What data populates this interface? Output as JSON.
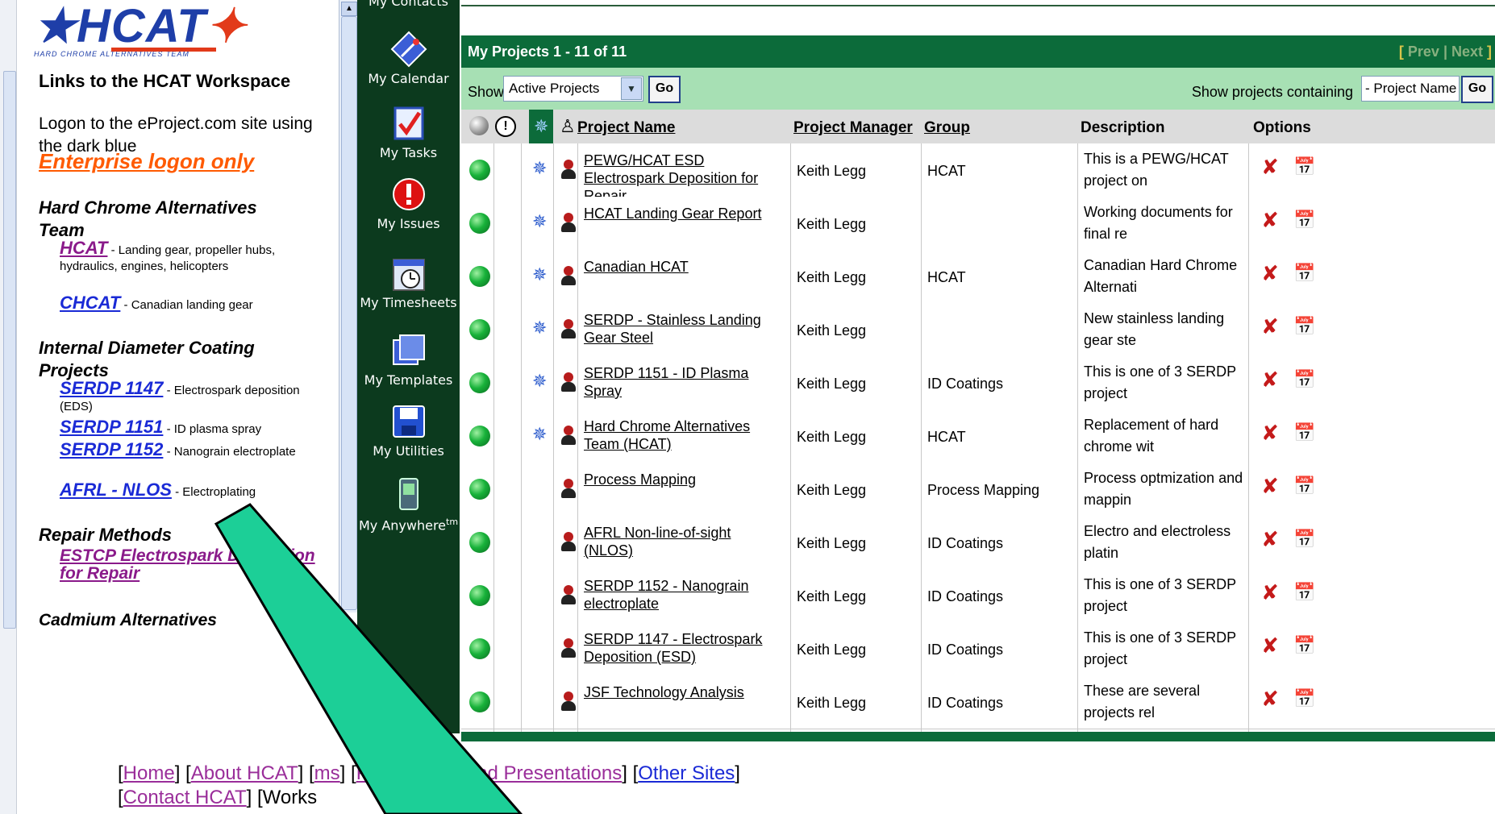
{
  "left": {
    "workspace_heading": "Links to the HCAT Workspace",
    "logon_text": "Logon to the eProject.com site using the dark blue",
    "enterprise_link": "Enterprise logon only",
    "logo_text": "HCAT",
    "logo_tagline": "HARD CHROME ALTERNATIVES TEAM",
    "sections": [
      {
        "title": "Hard Chrome Alternatives Team"
      },
      {
        "title": "Internal Diameter Coating Projects"
      },
      {
        "title": "Repair Methods"
      },
      {
        "title": "Cadmium Alternatives"
      }
    ],
    "links": [
      {
        "label": "HCAT",
        "desc": " - Landing gear, propeller hubs, hydraulics, engines, helicopters"
      },
      {
        "label": "CHCAT",
        "desc": " - Canadian landing gear"
      },
      {
        "label": "SERDP 1147",
        "desc": " - Electrospark deposition (EDS)"
      },
      {
        "label": "SERDP 1151",
        "desc": " - ID plasma spray"
      },
      {
        "label": "SERDP 1152",
        "desc": " - Nanograin electroplate"
      },
      {
        "label": "AFRL - NLOS",
        "desc": " - Electroplating"
      },
      {
        "label": "ESTCP Electrospark Deposition for Repair",
        "desc": ""
      }
    ]
  },
  "nav": {
    "items": [
      {
        "label": "My Contacts",
        "icon": "contacts-icon"
      },
      {
        "label": "My Calendar",
        "icon": "calendar-icon"
      },
      {
        "label": "My Tasks",
        "icon": "tasks-icon"
      },
      {
        "label": "My Issues",
        "icon": "issues-icon"
      },
      {
        "label": "My Timesheets",
        "icon": "timesheets-icon"
      },
      {
        "label": "My Templates",
        "icon": "templates-icon"
      },
      {
        "label": "My Utilities",
        "icon": "utilities-icon"
      },
      {
        "label": "My Anywhere",
        "icon": "anywhere-icon",
        "sup": "tm"
      }
    ]
  },
  "main": {
    "title": "My Projects 1 - 11 of 11",
    "pager": {
      "open": "[ ",
      "prev": "Prev",
      "sep": " | ",
      "next": "Next",
      "close": " ]"
    },
    "show_label": "Show",
    "show_value": "Active Projects",
    "go_label": "Go",
    "search_label": "Show projects containing",
    "search_value": "- Project Name -",
    "columns": {
      "project": "Project Name",
      "manager": "Project Manager",
      "group": "Group",
      "description": "Description",
      "options": "Options"
    },
    "rows": [
      {
        "name": "PEWG/HCAT ESD Electrospark Deposition for Repair",
        "manager": "Keith Legg",
        "group": "HCAT",
        "desc": "This is a PEWG/HCAT project on",
        "sun": true
      },
      {
        "name": "HCAT Landing Gear Report",
        "manager": "Keith Legg",
        "group": "",
        "desc": "Working documents for final re",
        "sun": true
      },
      {
        "name": "Canadian HCAT",
        "manager": "Keith Legg",
        "group": "HCAT",
        "desc": "Canadian Hard Chrome Alternati",
        "sun": true
      },
      {
        "name": "SERDP - Stainless Landing Gear Steel",
        "manager": "Keith Legg",
        "group": "",
        "desc": "New stainless landing gear ste",
        "sun": true
      },
      {
        "name": "SERDP 1151 - ID Plasma Spray",
        "manager": "Keith Legg",
        "group": "ID Coatings",
        "desc": "This is one of 3 SERDP project",
        "sun": true
      },
      {
        "name": "Hard Chrome Alternatives Team (HCAT)",
        "manager": "Keith Legg",
        "group": "HCAT",
        "desc": "Replacement of hard chrome wit",
        "sun": true
      },
      {
        "name": "Process Mapping",
        "manager": "Keith Legg",
        "group": "Process Mapping",
        "desc": "Process optmization and mappin",
        "sun": false
      },
      {
        "name": "AFRL Non-line-of-sight (NLOS)",
        "manager": "Keith Legg",
        "group": "ID Coatings",
        "desc": "Electro and electroless platin",
        "sun": false
      },
      {
        "name": "SERDP 1152 - Nanograin electroplate",
        "manager": "Keith Legg",
        "group": "ID Coatings",
        "desc": "This is one of 3 SERDP project",
        "sun": false
      },
      {
        "name": "SERDP 1147 - Electrospark Deposition (ESD)",
        "manager": "Keith Legg",
        "group": "ID Coatings",
        "desc": "This is one of 3 SERDP project",
        "sun": false
      },
      {
        "name": "JSF Technology Analysis",
        "manager": "Keith Legg",
        "group": "ID Coatings",
        "desc": "These are several projects rel",
        "sun": false
      }
    ]
  },
  "footer": {
    "line1": [
      {
        "label": "Home",
        "color": "purple"
      },
      {
        "label": "About HCAT",
        "color": "purple"
      },
      {
        "label": "ms",
        "color": "purple"
      },
      {
        "label": "Publications and Presentations",
        "color": "purple"
      },
      {
        "label": "Other Sites",
        "color": "blue"
      }
    ],
    "line2": [
      {
        "label": "Contact HCAT",
        "color": "purple"
      },
      {
        "label": "Works",
        "color": "plain"
      }
    ]
  },
  "colors": {
    "nav_bg": "#0c3a1e",
    "title_bg": "#0c6b3a",
    "filter_bg": "#a7e0b4",
    "callout": "#1ccf97"
  }
}
